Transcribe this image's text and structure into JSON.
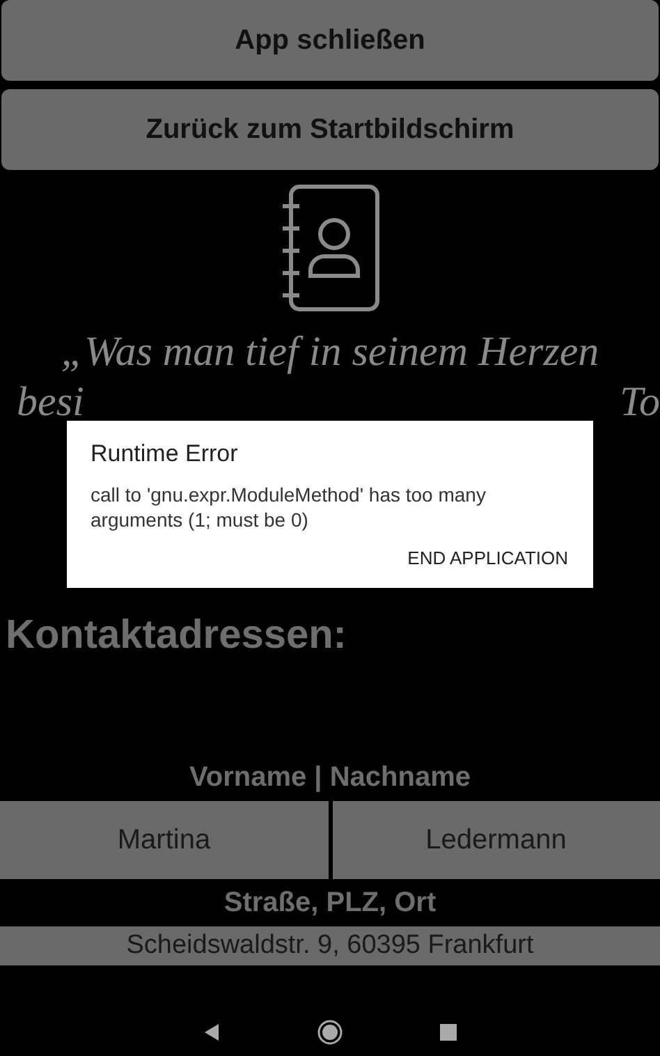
{
  "buttons": [
    {
      "label": "App schließen"
    },
    {
      "label": "Zurück zum Startbildschirm"
    }
  ],
  "quote": {
    "line_1": "„Was man tief in seinem Herzen",
    "line_2_left": "besi",
    "line_2_right": "To"
  },
  "dialog": {
    "title": "Runtime Error",
    "message": "call to 'gnu.expr.ModuleMethod' has too many arguments (1; must be 0)",
    "action": "END APPLICATION"
  },
  "heading": "Kontaktadressen:",
  "name_label": "Vorname | Nachname",
  "first_name": "Martina",
  "last_name": "Ledermann",
  "address_label": "Straße, PLZ, Ort",
  "address": "Scheidswaldstr. 9, 60395 Frankfurt"
}
